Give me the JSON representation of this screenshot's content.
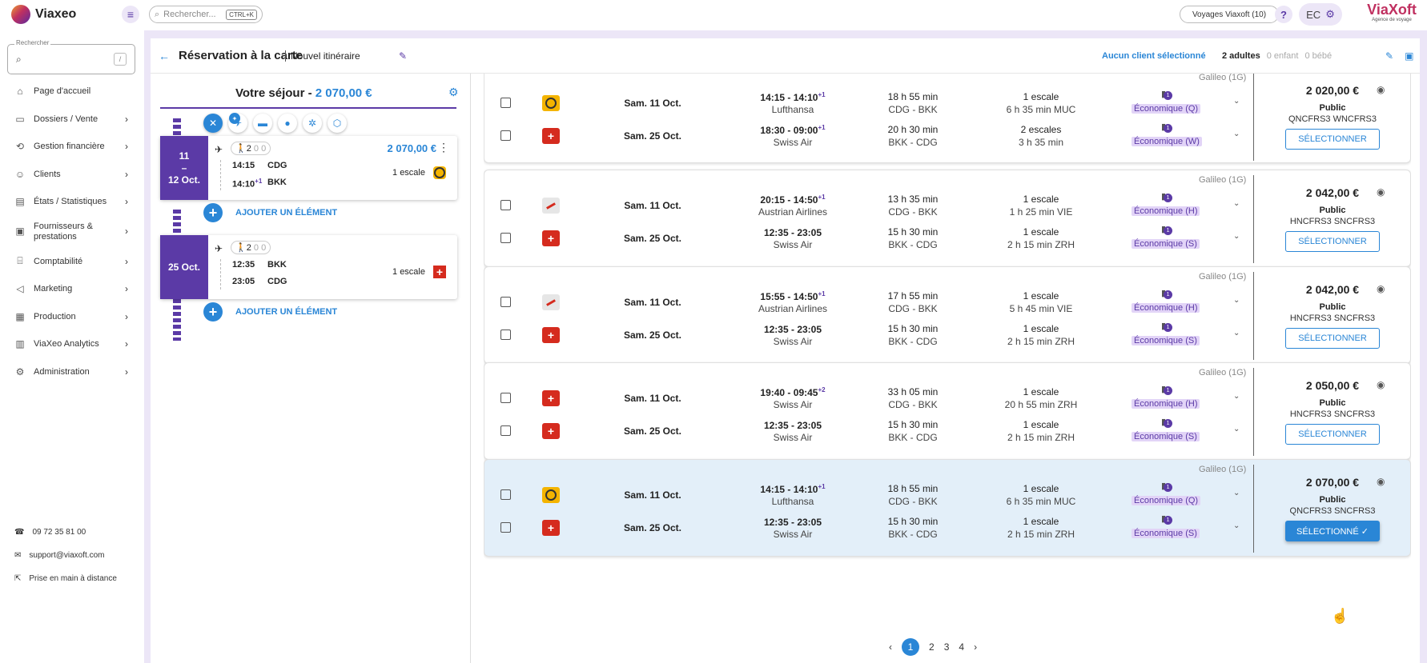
{
  "app": {
    "name": "Viaxeo",
    "search_placeholder": "Rechercher...",
    "search_shortcut": "CTRL+K",
    "agency": "Voyages Viaxoft (10)",
    "help": "?",
    "user_initials": "EC",
    "brand": "ViaXoft",
    "brand_tagline": "Agence de voyage"
  },
  "sidebar": {
    "search_label": "Rechercher",
    "search_shortcut": "/",
    "items": [
      {
        "label": "Page d'accueil",
        "icon": "home-icon"
      },
      {
        "label": "Dossiers / Vente",
        "icon": "folder-icon"
      },
      {
        "label": "Gestion financière",
        "icon": "finance-icon"
      },
      {
        "label": "Clients",
        "icon": "user-icon"
      },
      {
        "label": "États / Statistiques",
        "icon": "report-icon"
      },
      {
        "label": "Fournisseurs & prestations",
        "icon": "briefcase-icon"
      },
      {
        "label": "Comptabilité",
        "icon": "bank-icon"
      },
      {
        "label": "Marketing",
        "icon": "megaphone-icon"
      },
      {
        "label": "Production",
        "icon": "box-icon"
      },
      {
        "label": "ViaXeo Analytics",
        "icon": "analytics-icon"
      },
      {
        "label": "Administration",
        "icon": "gear-icon"
      }
    ],
    "phone": "09 72 35 81 00",
    "email": "support@viaxoft.com",
    "remote": "Prise en main à distance"
  },
  "header": {
    "title": "Réservation à la carte",
    "subtitle": "Nouvel itinéraire",
    "client": "Aucun client sélectionné",
    "adults": "2 adultes",
    "children": "0 enfant",
    "babies": "0 bébé"
  },
  "stay": {
    "label": "Votre séjour -",
    "total": "2 070,00 €",
    "add_label": "AJOUTER UN ÉLÉMENT",
    "cards": [
      {
        "date_top": "11",
        "date_sep": "–",
        "date_bottom": "12 Oct.",
        "pax_adults": "2",
        "pax_children": "0",
        "pax_babies": "0",
        "price": "2 070,00 €",
        "dep_time": "14:15",
        "dep_airport": "CDG",
        "arr_time": "14:10",
        "arr_plus": "+1",
        "arr_airport": "BKK",
        "stops": "1 escale"
      },
      {
        "date_top": "25 Oct.",
        "date_sep": "",
        "date_bottom": "",
        "pax_adults": "2",
        "pax_children": "0",
        "pax_babies": "0",
        "price": "",
        "dep_time": "12:35",
        "dep_airport": "BKK",
        "arr_time": "23:05",
        "arr_plus": "",
        "arr_airport": "CDG",
        "stops": "1 escale"
      }
    ]
  },
  "offers": [
    {
      "source": "Galileo (1G)",
      "price": "2 020,00 €",
      "fare": "Public",
      "codes": "QNCFRS3 WNCFRS3",
      "button": "SÉLECTIONNER",
      "selected": false,
      "segments": [
        {
          "airline_logo": "lufthansa",
          "date": "Sam. 11 Oct.",
          "dep": "14:15",
          "arr": "14:10",
          "plus": "+1",
          "carrier": "Lufthansa",
          "duration": "18 h 55 min",
          "route": "CDG - BKK",
          "stops": "1 escale",
          "via": "6 h 35 min MUC",
          "bags": "1",
          "cabin": "Économique (Q)"
        },
        {
          "airline_logo": "swiss",
          "date": "Sam. 25 Oct.",
          "dep": "18:30",
          "arr": "09:00",
          "plus": "+1",
          "carrier": "Swiss Air",
          "duration": "20 h 30 min",
          "route": "BKK - CDG",
          "stops": "2 escales",
          "via": "3 h 35 min",
          "bags": "1",
          "cabin": "Économique (W)"
        }
      ]
    },
    {
      "source": "Galileo (1G)",
      "price": "2 042,00 €",
      "fare": "Public",
      "codes": "HNCFRS3 SNCFRS3",
      "button": "SÉLECTIONNER",
      "selected": false,
      "segments": [
        {
          "airline_logo": "austrian",
          "date": "Sam. 11 Oct.",
          "dep": "20:15",
          "arr": "14:50",
          "plus": "+1",
          "carrier": "Austrian Airlines",
          "duration": "13 h 35 min",
          "route": "CDG - BKK",
          "stops": "1 escale",
          "via": "1 h 25 min VIE",
          "bags": "1",
          "cabin": "Économique (H)"
        },
        {
          "airline_logo": "swiss",
          "date": "Sam. 25 Oct.",
          "dep": "12:35",
          "arr": "23:05",
          "plus": "",
          "carrier": "Swiss Air",
          "duration": "15 h 30 min",
          "route": "BKK - CDG",
          "stops": "1 escale",
          "via": "2 h 15 min ZRH",
          "bags": "1",
          "cabin": "Économique (S)"
        }
      ]
    },
    {
      "source": "Galileo (1G)",
      "price": "2 042,00 €",
      "fare": "Public",
      "codes": "HNCFRS3 SNCFRS3",
      "button": "SÉLECTIONNER",
      "selected": false,
      "segments": [
        {
          "airline_logo": "austrian",
          "date": "Sam. 11 Oct.",
          "dep": "15:55",
          "arr": "14:50",
          "plus": "+1",
          "carrier": "Austrian Airlines",
          "duration": "17 h 55 min",
          "route": "CDG - BKK",
          "stops": "1 escale",
          "via": "5 h 45 min VIE",
          "bags": "1",
          "cabin": "Économique (H)"
        },
        {
          "airline_logo": "swiss",
          "date": "Sam. 25 Oct.",
          "dep": "12:35",
          "arr": "23:05",
          "plus": "",
          "carrier": "Swiss Air",
          "duration": "15 h 30 min",
          "route": "BKK - CDG",
          "stops": "1 escale",
          "via": "2 h 15 min ZRH",
          "bags": "1",
          "cabin": "Économique (S)"
        }
      ]
    },
    {
      "source": "Galileo (1G)",
      "price": "2 050,00 €",
      "fare": "Public",
      "codes": "HNCFRS3 SNCFRS3",
      "button": "SÉLECTIONNER",
      "selected": false,
      "segments": [
        {
          "airline_logo": "swiss",
          "date": "Sam. 11 Oct.",
          "dep": "19:40",
          "arr": "09:45",
          "plus": "+2",
          "carrier": "Swiss Air",
          "duration": "33 h 05 min",
          "route": "CDG - BKK",
          "stops": "1 escale",
          "via": "20 h 55 min ZRH",
          "bags": "1",
          "cabin": "Économique (H)"
        },
        {
          "airline_logo": "swiss",
          "date": "Sam. 25 Oct.",
          "dep": "12:35",
          "arr": "23:05",
          "plus": "",
          "carrier": "Swiss Air",
          "duration": "15 h 30 min",
          "route": "BKK - CDG",
          "stops": "1 escale",
          "via": "2 h 15 min ZRH",
          "bags": "1",
          "cabin": "Économique (S)"
        }
      ]
    },
    {
      "source": "Galileo (1G)",
      "price": "2 070,00 €",
      "fare": "Public",
      "codes": "QNCFRS3 SNCFRS3",
      "button": "SÉLECTIONNÉ ✓",
      "selected": true,
      "segments": [
        {
          "airline_logo": "lufthansa",
          "date": "Sam. 11 Oct.",
          "dep": "14:15",
          "arr": "14:10",
          "plus": "+1",
          "carrier": "Lufthansa",
          "duration": "18 h 55 min",
          "route": "CDG - BKK",
          "stops": "1 escale",
          "via": "6 h 35 min MUC",
          "bags": "1",
          "cabin": "Économique (Q)"
        },
        {
          "airline_logo": "swiss",
          "date": "Sam. 25 Oct.",
          "dep": "12:35",
          "arr": "23:05",
          "plus": "",
          "carrier": "Swiss Air",
          "duration": "15 h 30 min",
          "route": "BKK - CDG",
          "stops": "1 escale",
          "via": "2 h 15 min ZRH",
          "bags": "1",
          "cabin": "Économique (S)"
        }
      ]
    }
  ],
  "pager": {
    "prev": "‹",
    "pages": [
      "1",
      "2",
      "3",
      "4"
    ],
    "current": "1",
    "next": "›"
  },
  "colors": {
    "accent": "#2a86d6",
    "brand": "#5b3aa6",
    "cabin_bg": "#e2d4f7",
    "selected_bg": "#e3eff9"
  }
}
